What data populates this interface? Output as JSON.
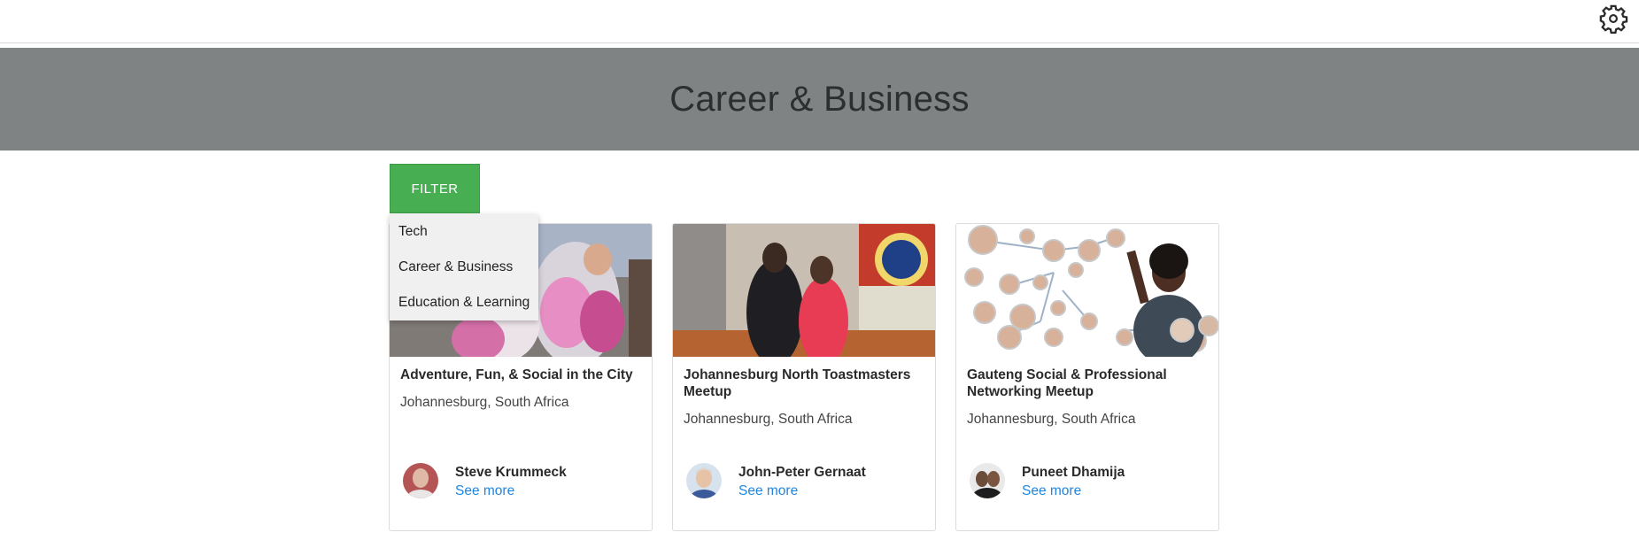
{
  "header": {
    "settings_icon": "gear-icon"
  },
  "hero": {
    "title": "Career & Business"
  },
  "filter": {
    "button_label": "FILTER",
    "options": [
      "Tech",
      "Career & Business",
      "Education & Learning"
    ]
  },
  "cards": [
    {
      "title": "Adventure, Fun, & Social in the City",
      "location": "Johannesburg, South Africa",
      "host": "Steve Krummeck",
      "more": "See more"
    },
    {
      "title": "Johannesburg North Toastmasters Meetup",
      "location": "Johannesburg, South Africa",
      "host": "John-Peter Gernaat",
      "more": "See more"
    },
    {
      "title": "Gauteng Social & Professional Networking Meetup",
      "location": "Johannesburg, South Africa",
      "host": "Puneet Dhamija",
      "more": "See more"
    }
  ],
  "colors": {
    "hero_bg": "#7f8383",
    "filter_green": "#47ae52",
    "link_blue": "#1f86e0"
  }
}
